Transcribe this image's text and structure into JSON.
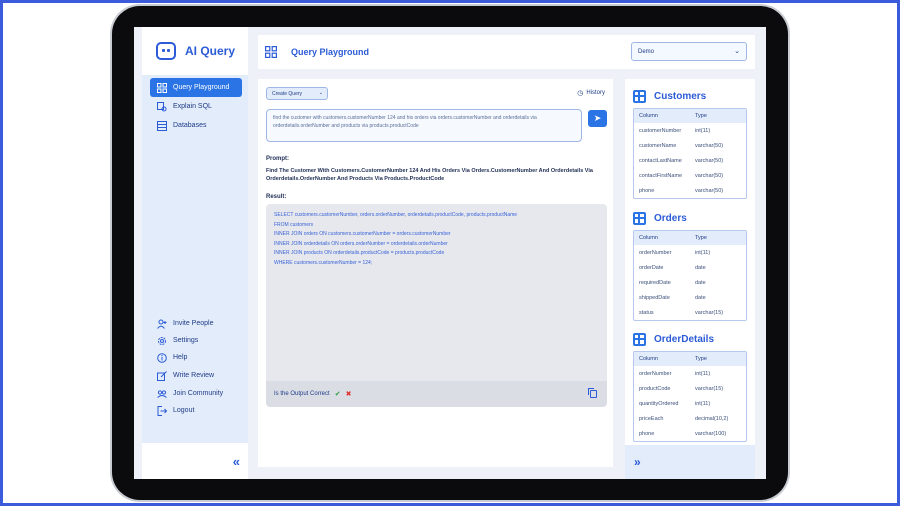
{
  "app": {
    "name": "AI Query"
  },
  "sidebar": {
    "nav": [
      {
        "label": "Query Playground",
        "icon": "grid-icon",
        "active": true
      },
      {
        "label": "Explain SQL",
        "icon": "explain-icon",
        "active": false
      },
      {
        "label": "Databases",
        "icon": "database-icon",
        "active": false
      }
    ],
    "footer_nav": [
      {
        "label": "Invite People",
        "icon": "invite-icon"
      },
      {
        "label": "Settings",
        "icon": "gear-icon"
      },
      {
        "label": "Help",
        "icon": "help-icon"
      },
      {
        "label": "Write Review",
        "icon": "edit-icon"
      },
      {
        "label": "Join Community",
        "icon": "community-icon"
      },
      {
        "label": "Logout",
        "icon": "logout-icon"
      }
    ],
    "collapse_glyph": "«"
  },
  "header": {
    "title": "Query Playground",
    "project_select": "Demo"
  },
  "main": {
    "mode_dropdown": "Create Query",
    "history_label": "History",
    "query_text": "find the customer with customers.customerNumber 124 and his orders via orders.customerNumber and orderdetails via orderdetails.orderNumber and products via products.productCode",
    "prompt_label": "Prompt:",
    "prompt_text": "Find The Customer With Customers.CustomerNumber 124 And His Orders Via Orders.CustomerNumber And Orderdetails Via Orderdetails.OrderNumber And Products Via Products.ProductCode",
    "result_label": "Result:",
    "result_lines": [
      "SELECT customers.customerNumber, orders.orderNumber, orderdetails.productCode, products.productName",
      "FROM customers",
      "INNER JOIN orders ON customers.customerNumber = orders.customerNumber",
      "INNER JOIN orderdetails ON orders.orderNumber = orderdetails.orderNumber",
      "INNER JOIN products ON orderdetails.productCode = products.productCode",
      "WHERE customers.customerNumber = 124;"
    ],
    "feedback_label": "Is the Output Correct"
  },
  "schema": {
    "column_header": "Column",
    "type_header": "Type",
    "tables": [
      {
        "name": "Customers",
        "rows": [
          [
            "customerNumber",
            "int(11)"
          ],
          [
            "customerName",
            "varchar(50)"
          ],
          [
            "contactLastName",
            "varchar(50)"
          ],
          [
            "contactFirstName",
            "varchar(50)"
          ],
          [
            "phone",
            "varchar(50)"
          ]
        ]
      },
      {
        "name": "Orders",
        "rows": [
          [
            "orderNumber",
            "int(11)"
          ],
          [
            "orderDate",
            "date"
          ],
          [
            "requiredDate",
            "date"
          ],
          [
            "shippedDate",
            "date"
          ],
          [
            "status",
            "varchar(15)"
          ]
        ]
      },
      {
        "name": "OrderDetails",
        "rows": [
          [
            "orderNumber",
            "int(11)"
          ],
          [
            "productCode",
            "varchar(15)"
          ],
          [
            "quantityOrdered",
            "int(11)"
          ],
          [
            "priceEach",
            "decimal(10,2)"
          ],
          [
            "phone",
            "varchar(100)"
          ]
        ]
      }
    ],
    "expand_glyph": "»"
  },
  "colors": {
    "accent": "#2b74e6",
    "brand": "#2b5bd6",
    "frame": "#3b5bdb"
  }
}
